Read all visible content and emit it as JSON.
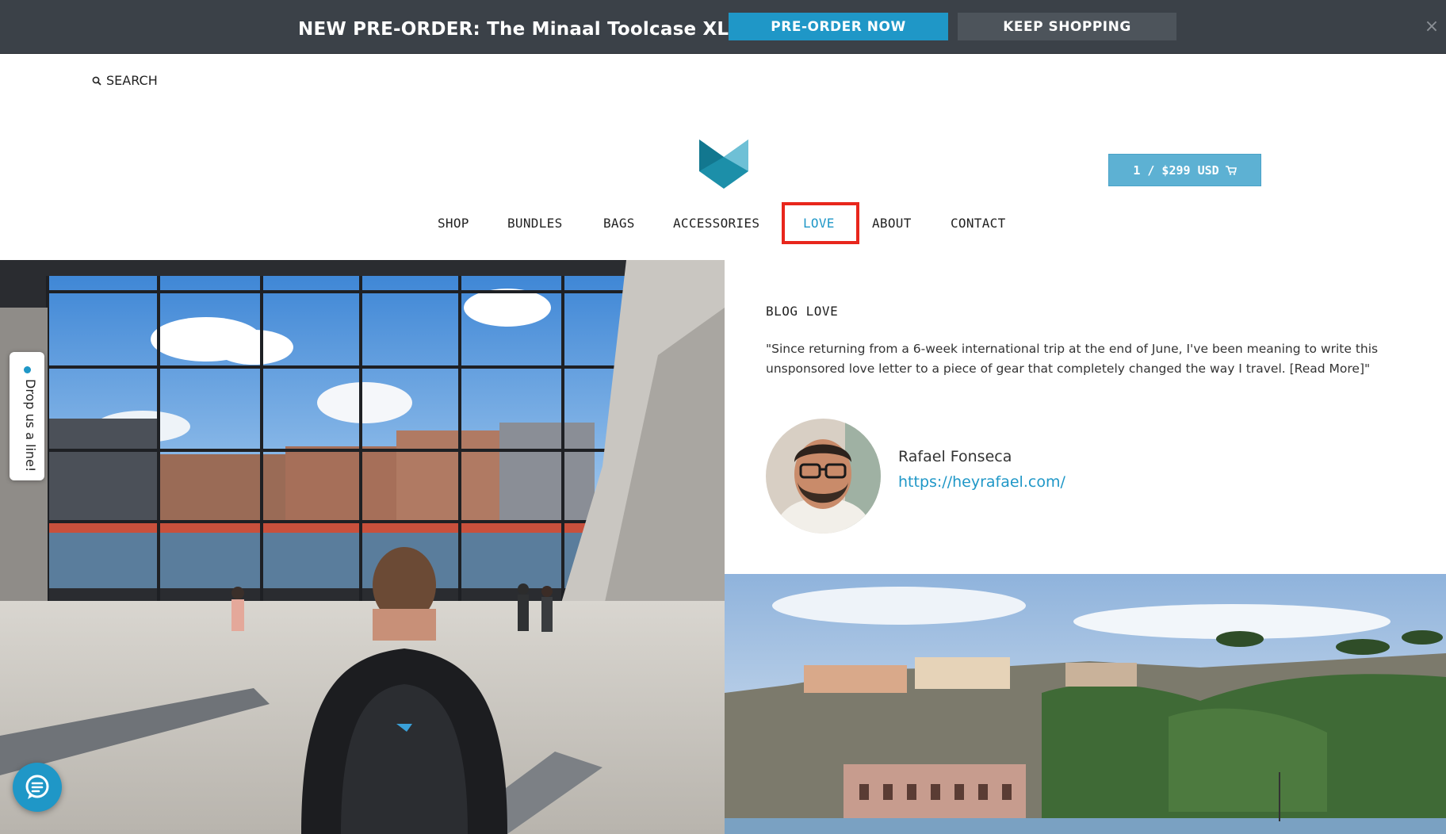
{
  "announcement": {
    "text": "NEW PRE-ORDER: The Minaal Toolcase XL",
    "preorder_label": "PRE-ORDER NOW",
    "keep_shopping_label": "KEEP SHOPPING",
    "close_symbol": "×"
  },
  "search": {
    "label": "SEARCH",
    "icon": "search-icon"
  },
  "logo": {
    "icon": "minaal-logo"
  },
  "cart": {
    "label": "1 / $299 USD",
    "icon": "cart-icon"
  },
  "nav": {
    "items": [
      {
        "label": "SHOP"
      },
      {
        "label": "BUNDLES"
      },
      {
        "label": "BAGS"
      },
      {
        "label": "ACCESSORIES"
      },
      {
        "label": "LOVE",
        "active": true
      },
      {
        "label": "ABOUT"
      },
      {
        "label": "CONTACT"
      }
    ]
  },
  "blog": {
    "heading": "BLOG LOVE",
    "quote": "\"Since returning from a 6-week international trip at the end of June, I've been meaning to write this unsponsored love letter to a piece of gear that completely changed the way I travel. [Read More]\"",
    "author_name": "Rafael Fonseca",
    "author_link": "https://heyrafael.com/"
  },
  "feedback_tab": {
    "label": "Drop us a line!"
  },
  "chat": {
    "icon": "chat-icon"
  },
  "colors": {
    "accent": "#1f97c7",
    "announcement_bg": "#3b4148",
    "cart_bg": "#5db1d3",
    "highlight": "#e8261c"
  }
}
